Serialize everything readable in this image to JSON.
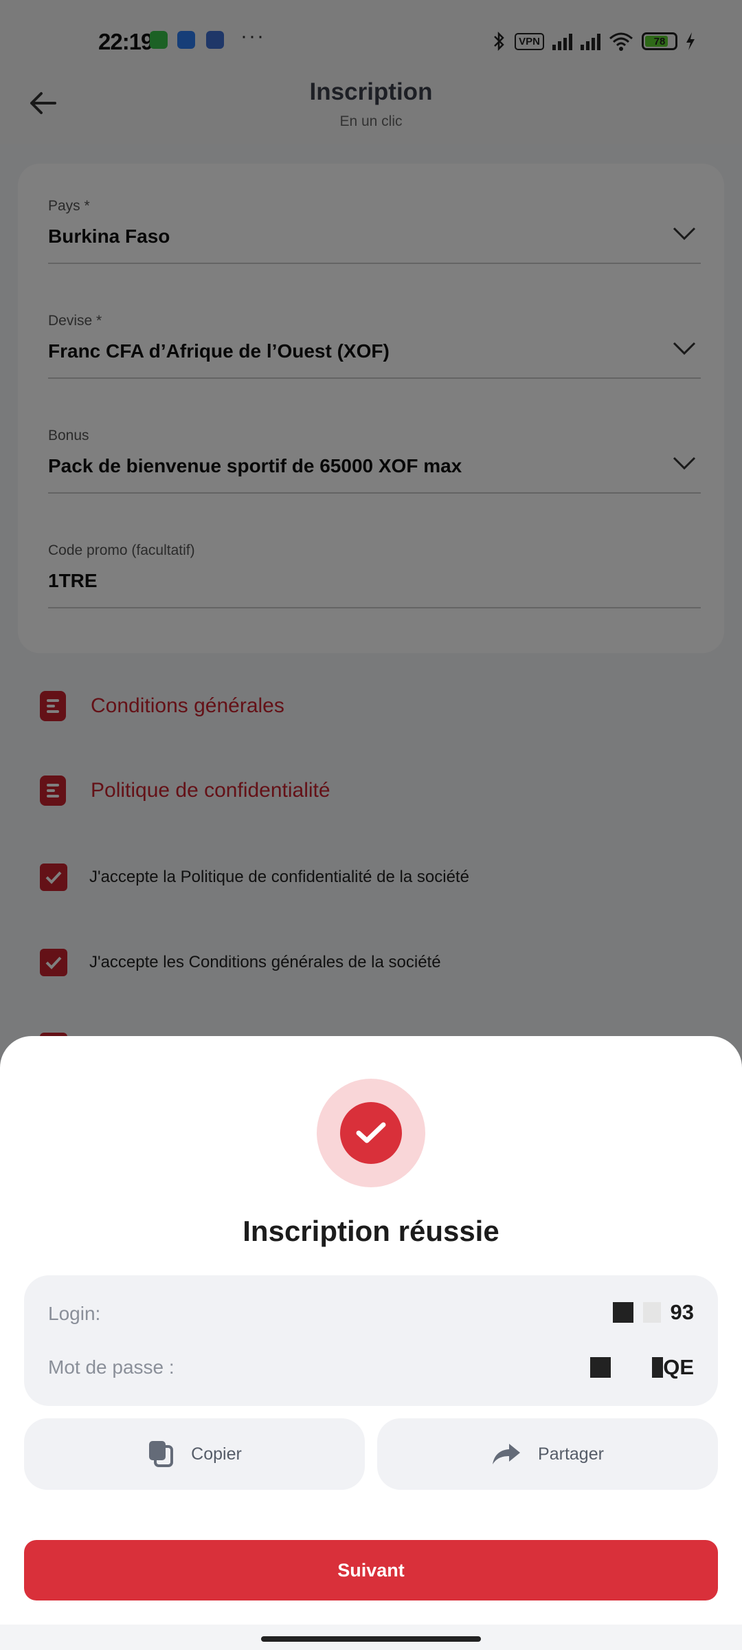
{
  "status_bar": {
    "time": "22:19",
    "app_icons": [
      "whatsapp-icon",
      "messages-icon",
      "app-icon"
    ],
    "more": "···",
    "vpn": "VPN",
    "battery": "78"
  },
  "header": {
    "title": "Inscription",
    "subtitle": "En un clic"
  },
  "form": {
    "country": {
      "label": "Pays *",
      "value": "Burkina Faso"
    },
    "currency": {
      "label": "Devise *",
      "value": "Franc CFA d’Afrique de l’Ouest (XOF)"
    },
    "bonus": {
      "label": "Bonus",
      "value": "Pack de bienvenue sportif de 65000 XOF max"
    },
    "promo": {
      "label": "Code promo (facultatif)",
      "value": "1TRE"
    }
  },
  "links": {
    "terms": "Conditions générales",
    "privacy": "Politique de confidentialité"
  },
  "checkboxes": {
    "accept_privacy": "J'accepte la Politique de confidentialité de la société",
    "accept_terms": "J'accepte les Conditions générales de la société"
  },
  "sheet": {
    "title": "Inscription réussie",
    "login_label": "Login:",
    "login_value_suffix": "93",
    "password_label": "Mot de passe :",
    "password_value_suffix": "QE",
    "copy_label": "Copier",
    "share_label": "Partager",
    "next_label": "Suivant"
  },
  "colors": {
    "accent": "#d9303a",
    "link": "#c8232e",
    "success_ring": "#f9d6d8"
  }
}
